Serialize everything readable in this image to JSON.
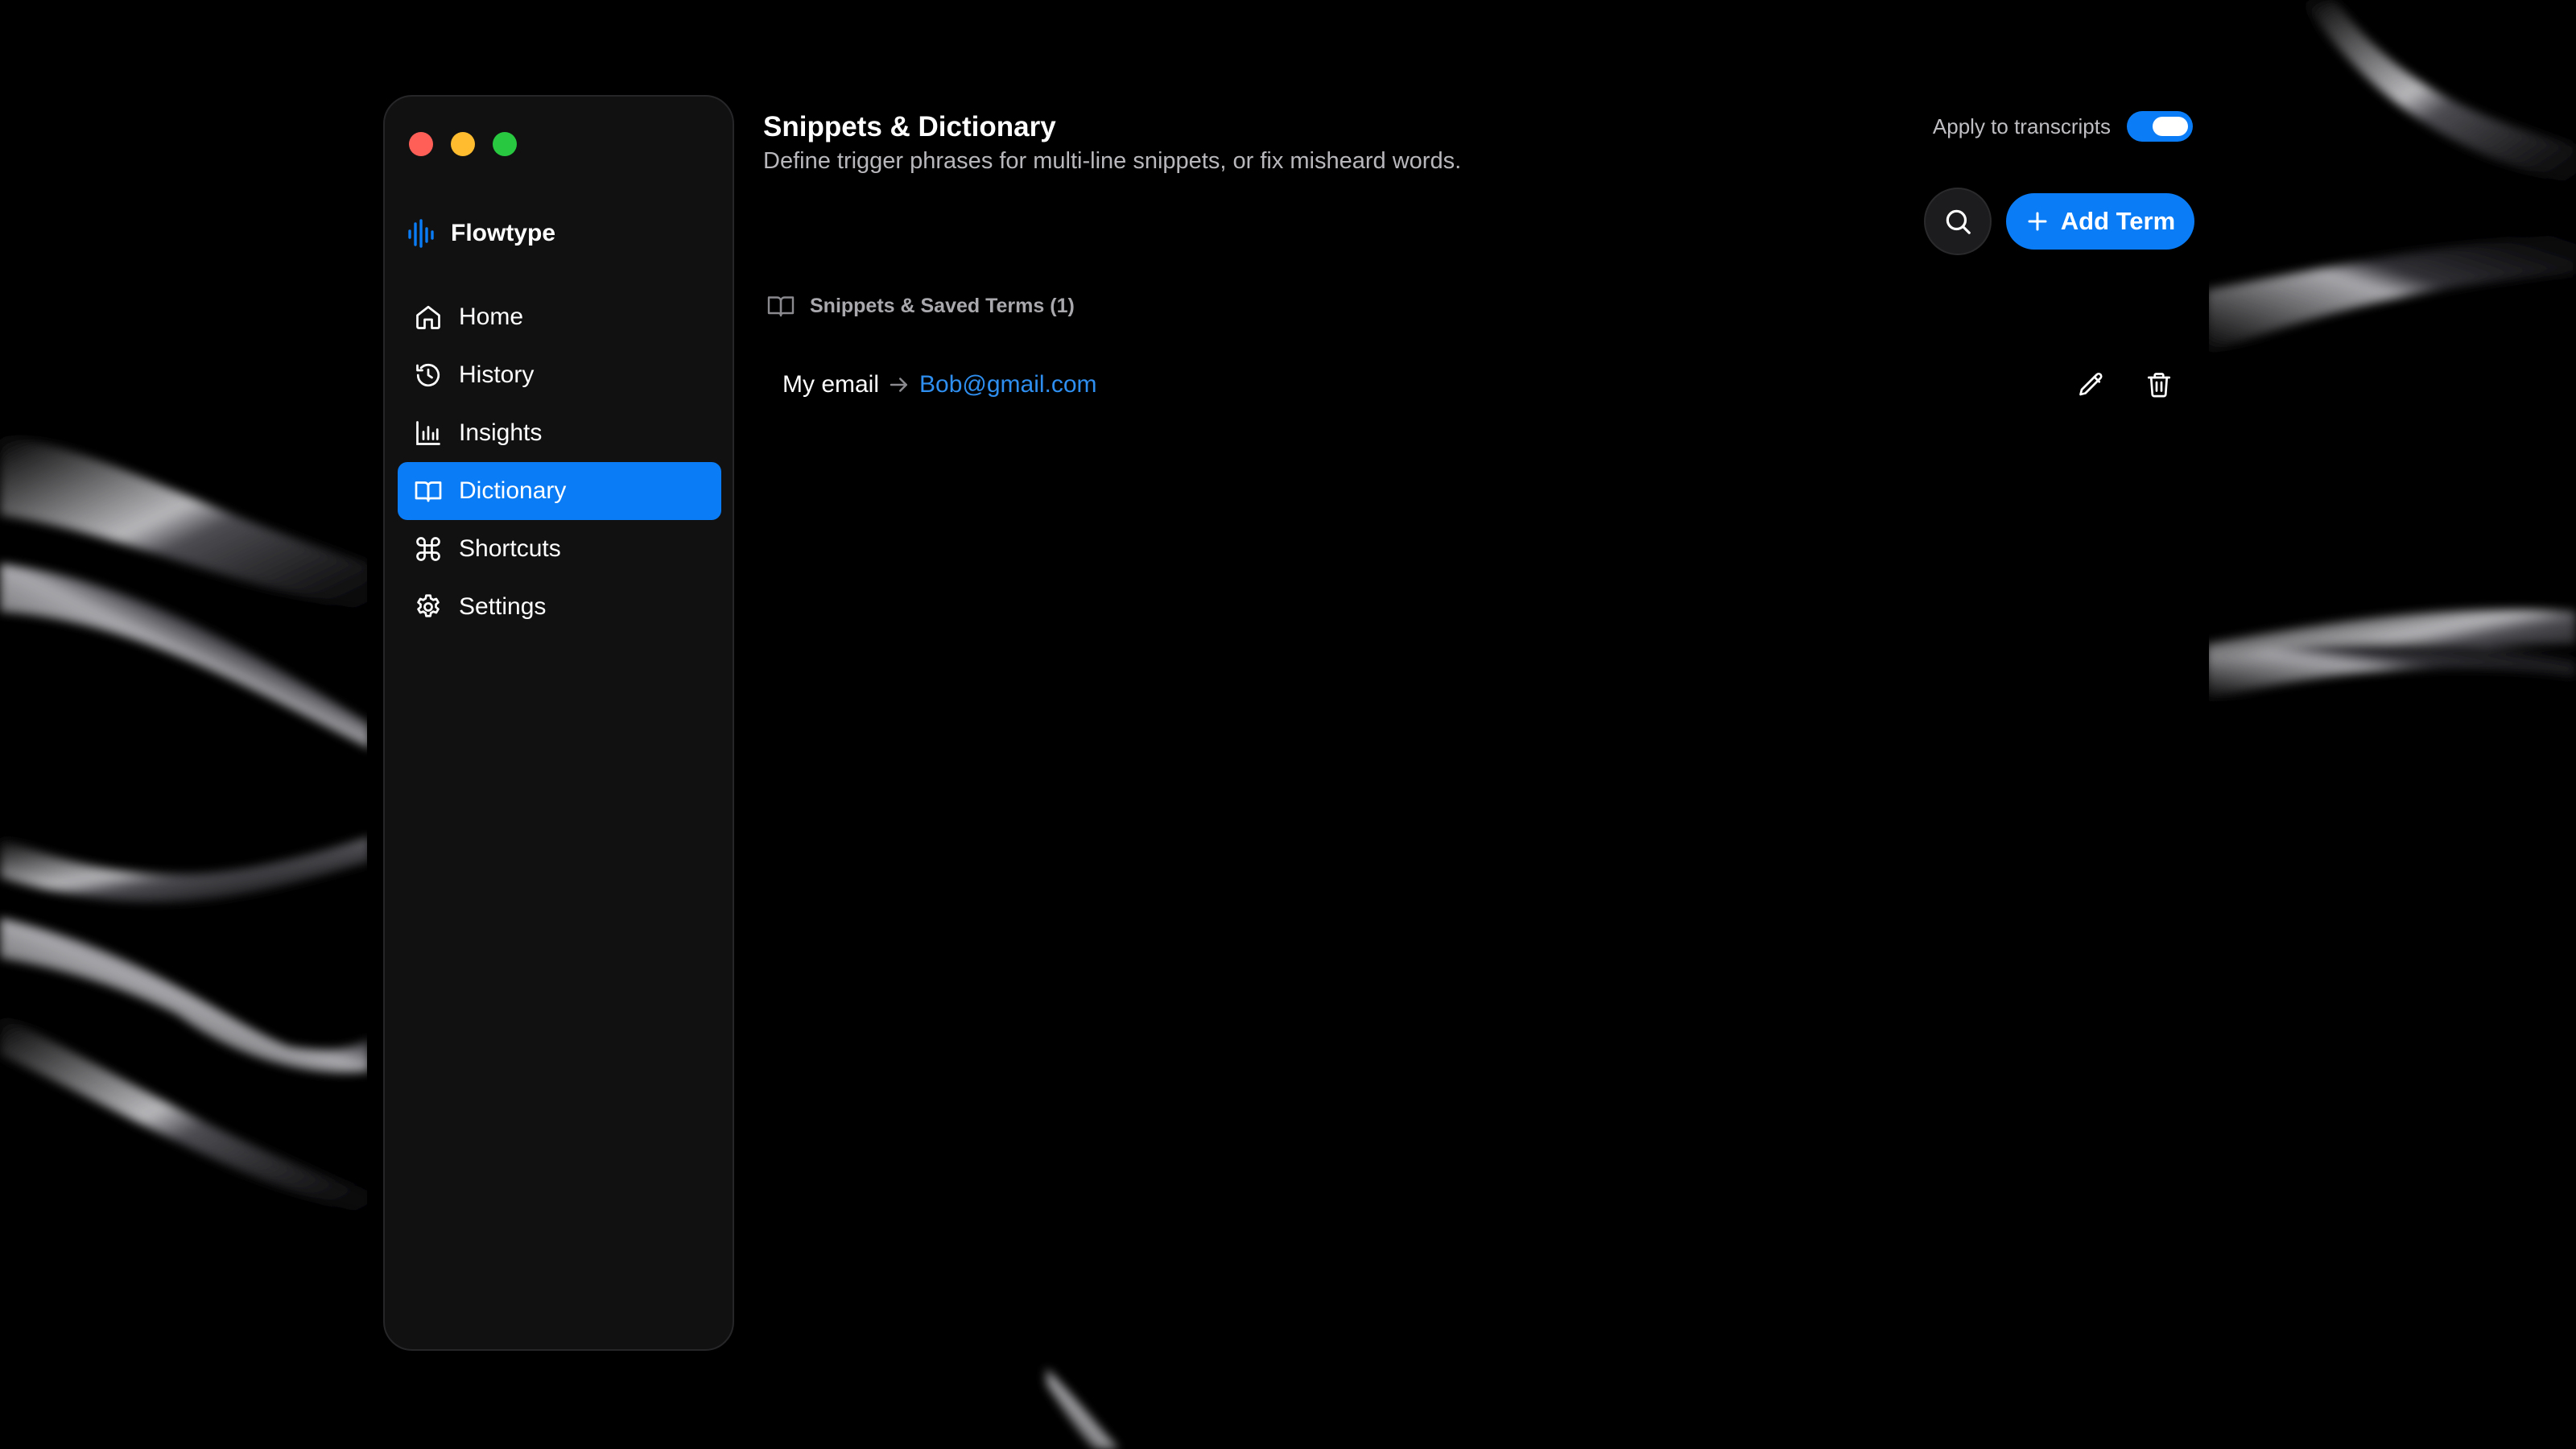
{
  "app": {
    "name": "Flowtype"
  },
  "sidebar": {
    "items": [
      {
        "label": "Home",
        "icon": "home-icon",
        "active": false
      },
      {
        "label": "History",
        "icon": "history-icon",
        "active": false
      },
      {
        "label": "Insights",
        "icon": "bar-chart-icon",
        "active": false
      },
      {
        "label": "Dictionary",
        "icon": "book-icon",
        "active": true
      },
      {
        "label": "Shortcuts",
        "icon": "command-icon",
        "active": false
      },
      {
        "label": "Settings",
        "icon": "gear-icon",
        "active": false
      }
    ]
  },
  "header": {
    "title": "Snippets & Dictionary",
    "subtitle": "Define trigger phrases for multi-line snippets, or fix misheard words."
  },
  "apply_toggle": {
    "label": "Apply to transcripts",
    "on": true
  },
  "toolbar": {
    "search_icon": "search-icon",
    "add_label": "Add Term"
  },
  "section": {
    "label": "Snippets & Saved Terms (1)"
  },
  "terms": [
    {
      "trigger": "My email",
      "value": "Bob@gmail.com"
    }
  ],
  "colors": {
    "accent": "#0a7cf5",
    "link": "#2f8ff0",
    "sidebar_bg": "#111112",
    "close": "#ff5f57",
    "minimize": "#febc2e",
    "zoom": "#28c840"
  }
}
